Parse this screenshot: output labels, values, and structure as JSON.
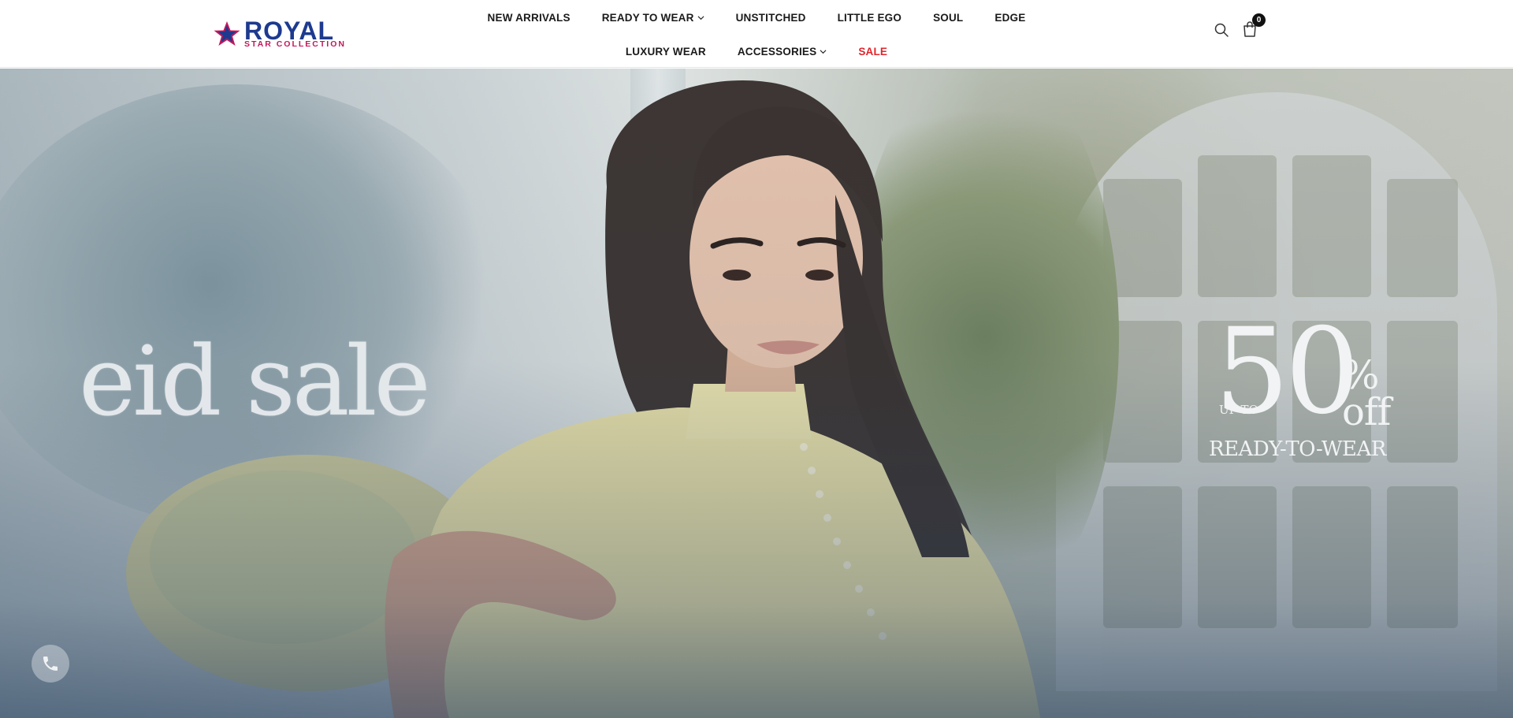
{
  "brand": {
    "name": "ROYAL",
    "tagline": "STAR COLLECTION",
    "primary_color": "#1d3a8f",
    "accent_color": "#c2185b"
  },
  "nav": {
    "row1": [
      {
        "label": "NEW ARRIVALS",
        "has_dropdown": false
      },
      {
        "label": "READY TO WEAR",
        "has_dropdown": true
      },
      {
        "label": "UNSTITCHED",
        "has_dropdown": false
      },
      {
        "label": "LITTLE EGO",
        "has_dropdown": false
      },
      {
        "label": "SOUL",
        "has_dropdown": false
      },
      {
        "label": "EDGE",
        "has_dropdown": false
      }
    ],
    "row2": [
      {
        "label": "LUXURY WEAR",
        "has_dropdown": false
      },
      {
        "label": "ACCESSORIES",
        "has_dropdown": true
      },
      {
        "label": "SALE",
        "has_dropdown": false,
        "color": "#e0252b"
      }
    ]
  },
  "header_icons": {
    "search": "search-icon",
    "cart": "shopping-bag-icon",
    "cart_count": "0"
  },
  "hero": {
    "headline": "eid sale",
    "promo": {
      "prefix": "UP TO",
      "amount": "50",
      "percent_sign": "%",
      "suffix": "off",
      "category": "READY-TO-WEAR"
    },
    "floating_button": "phone-icon"
  }
}
